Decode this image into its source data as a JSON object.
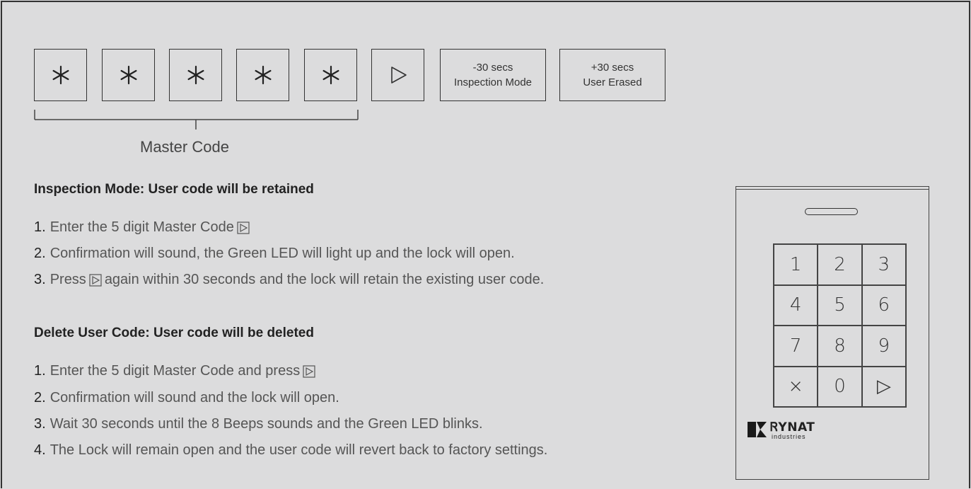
{
  "keys": {
    "star": "*",
    "minus_line1": "-30 secs",
    "minus_line2": "Inspection Mode",
    "plus_line1": "+30 secs",
    "plus_line2": "User Erased"
  },
  "master_code_label": "Master Code",
  "inspection": {
    "heading": "Inspection Mode: User code will be retained",
    "steps": [
      {
        "num": "1.",
        "pre": "Enter the 5 digit Master Code",
        "post": ""
      },
      {
        "num": "2.",
        "pre": "Confirmation will sound, the Green LED will light up and the lock will open.",
        "post": ""
      },
      {
        "num": "3.",
        "pre": "Press",
        "post": "again within 30 seconds and the lock will retain the existing user code."
      }
    ]
  },
  "delete": {
    "heading": "Delete User Code: User code will be deleted",
    "steps": [
      {
        "num": "1.",
        "pre": "Enter the 5 digit Master Code and press",
        "post": ""
      },
      {
        "num": "2.",
        "pre": "Confirmation will sound and the lock will open.",
        "post": ""
      },
      {
        "num": "3.",
        "pre": "Wait 30 seconds until the 8 Beeps sounds and the Green LED blinks.",
        "post": ""
      },
      {
        "num": "4.",
        "pre": "The Lock will remain open and the user code will revert back to factory settings.",
        "post": ""
      }
    ]
  },
  "device": {
    "keys": [
      "1",
      "2",
      "3",
      "4",
      "5",
      "6",
      "7",
      "8",
      "9",
      "×",
      "0",
      "▷"
    ],
    "brand_name": "ᏒYNAT",
    "brand_sub": "industries"
  },
  "icons": {
    "star": "asterisk-icon",
    "play": "play-triangle-icon",
    "brand_logo": "rynat-logo-icon"
  }
}
